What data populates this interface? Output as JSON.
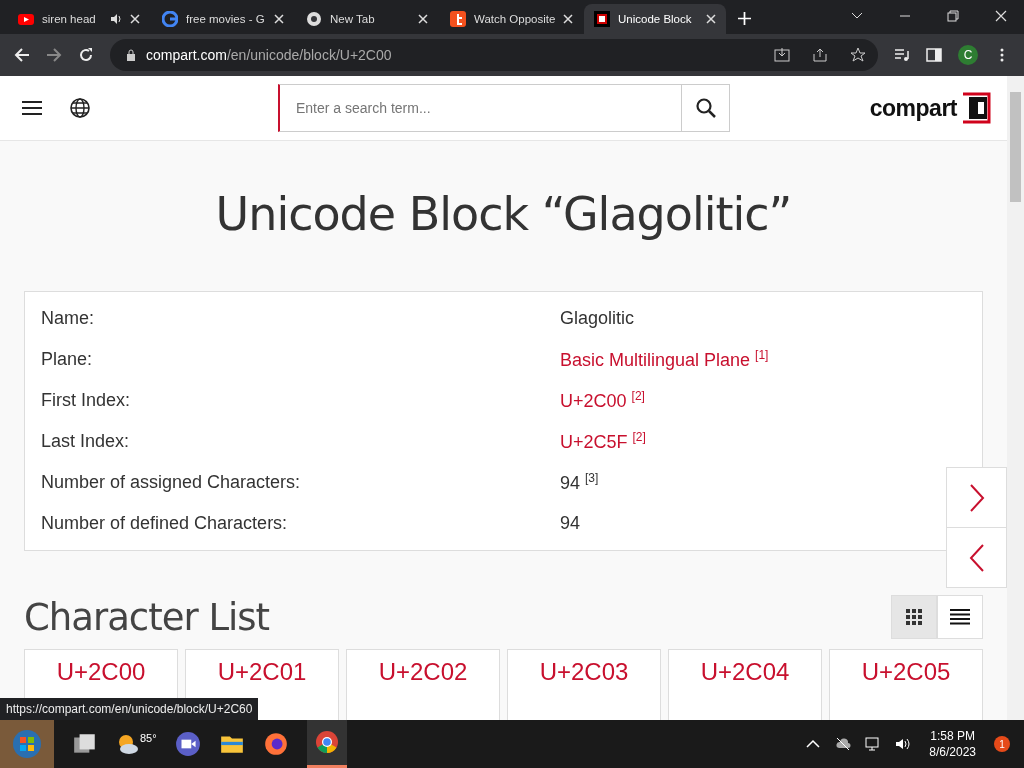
{
  "browser": {
    "tabs": [
      {
        "kind": "youtube",
        "title": "siren head",
        "audio": true,
        "selected": false
      },
      {
        "kind": "google",
        "title": "free movies - G",
        "audio": false,
        "selected": false
      },
      {
        "kind": "chrome",
        "title": "New Tab",
        "audio": false,
        "selected": false
      },
      {
        "kind": "t",
        "title": "Watch Opposite",
        "audio": false,
        "selected": false
      },
      {
        "kind": "compart",
        "title": "Unicode Block",
        "audio": false,
        "selected": true
      }
    ],
    "url_host": "compart.com",
    "url_path": "/en/unicode/block/U+2C00",
    "profile": "C"
  },
  "header": {
    "search": {
      "placeholder": "Enter a search term..."
    },
    "logo": "compart"
  },
  "title": "Unicode Block “Glagolitic”",
  "properties": [
    {
      "label": "Name:",
      "value": "Glagolitic",
      "link": false
    },
    {
      "label": "Plane:",
      "value": "Basic Multilingual Plane $^{[1]}$",
      "link": true
    },
    {
      "label": "First Index:",
      "value": "U+2C00 $^{[2]}$",
      "link": true
    },
    {
      "label": "Last Index:",
      "value": "U+2C5F $^{[2]}$",
      "link": true
    },
    {
      "label": "Number of assigned Characters:",
      "value": "94 $^{[3]}$",
      "link": false
    },
    {
      "label": "Number of defined Characters:",
      "value": "94",
      "link": false
    }
  ],
  "character_list": {
    "heading": "Character List",
    "views": [
      {
        "kind": "grid",
        "selected": true
      },
      {
        "kind": "list",
        "selected": false
      }
    ],
    "codes": [
      "U+2C00",
      "U+2C01",
      "U+2C02",
      "U+2C03",
      "U+2C04",
      "U+2C05"
    ]
  },
  "status_url": "https://compart.com/en/unicode/block/U+2C60",
  "taskbar": {
    "weather": "85°",
    "time": "1:58 PM",
    "date": "8/6/2023",
    "notifications": "1"
  }
}
